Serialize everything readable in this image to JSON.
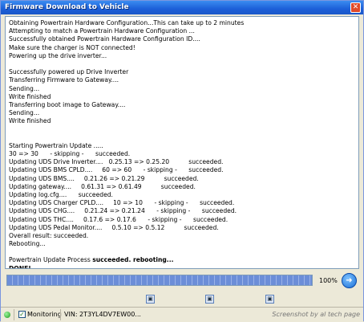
{
  "window": {
    "title": "Firmware Download to Vehicle"
  },
  "log": {
    "lines": [
      {
        "text": "Obtaining Powertrain Hardware Configuration...This can take up to 2 minutes"
      },
      {
        "text": "Attempting to match a Powertrain Hardware Configuration ..."
      },
      {
        "text": "Successfully obtained Powertrain Hardware Configuration ID...."
      },
      {
        "text": "Make sure the charger is NOT connected!"
      },
      {
        "text": "Powering up the drive inverter..."
      },
      {
        "text": ""
      },
      {
        "text": "Successfully powered up Drive Inverter"
      },
      {
        "text": "Transferring Firmware to Gateway...."
      },
      {
        "text": "Sending..."
      },
      {
        "text": "Write finished"
      },
      {
        "text": "Transferring boot image to Gateway...."
      },
      {
        "text": "Sending..."
      },
      {
        "text": "Write finished"
      },
      {
        "text": ""
      },
      {
        "text": ""
      },
      {
        "text": "Starting Powertrain Update ....."
      },
      {
        "text": "30 => 30      - skipping -      succeeded."
      },
      {
        "text": "Updating UDS Drive Inverter....   0.25.13 => 0.25.20          succeeded."
      },
      {
        "text": "Updating UDS BMS CPLD....     60 => 60      - skipping -      succeeded."
      },
      {
        "text": "Updating UDS BMS....     0.21.26 => 0.21.29          succeeded."
      },
      {
        "text": "Updating gateway....     0.61.31 => 0.61.49          succeeded."
      },
      {
        "text": "Updating log.cfg....      succeeded."
      },
      {
        "text": "Updating UDS Charger CPLD....     10 => 10      - skipping -      succeeded."
      },
      {
        "text": "Updating UDS CHG....     0.21.24 => 0.21.24      - skipping -      succeeded."
      },
      {
        "text": "Updating UDS THC....     0.17.6 => 0.17.6      - skipping -      succeeded."
      },
      {
        "text": "Updating UDS Pedal Monitor....     0.5.10 => 0.5.12          succeeded."
      },
      {
        "text": "Overall result: succeeded."
      },
      {
        "text": "Rebooting..."
      },
      {
        "text": ""
      },
      {
        "text": "Powertrain Update Process ",
        "bold_suffix": "succeeded. rebooting..."
      },
      {
        "text": "DONE!",
        "bold": true
      }
    ]
  },
  "progress": {
    "fraction": 1.0,
    "label": "100%"
  },
  "toolbar": {
    "icons": [
      "disk-icon",
      "disk-icon",
      "disk-icon"
    ]
  },
  "status": {
    "monitoring_label": "Monitoring",
    "monitoring_checked": true,
    "vin": "VIN: 2T3YL4DV7EW00...",
    "credit": "Screenshot by al tech page"
  },
  "colors": {
    "accent": "#1c5fd8",
    "progress": "#6c8ed8",
    "led": "#1f9a1f"
  }
}
